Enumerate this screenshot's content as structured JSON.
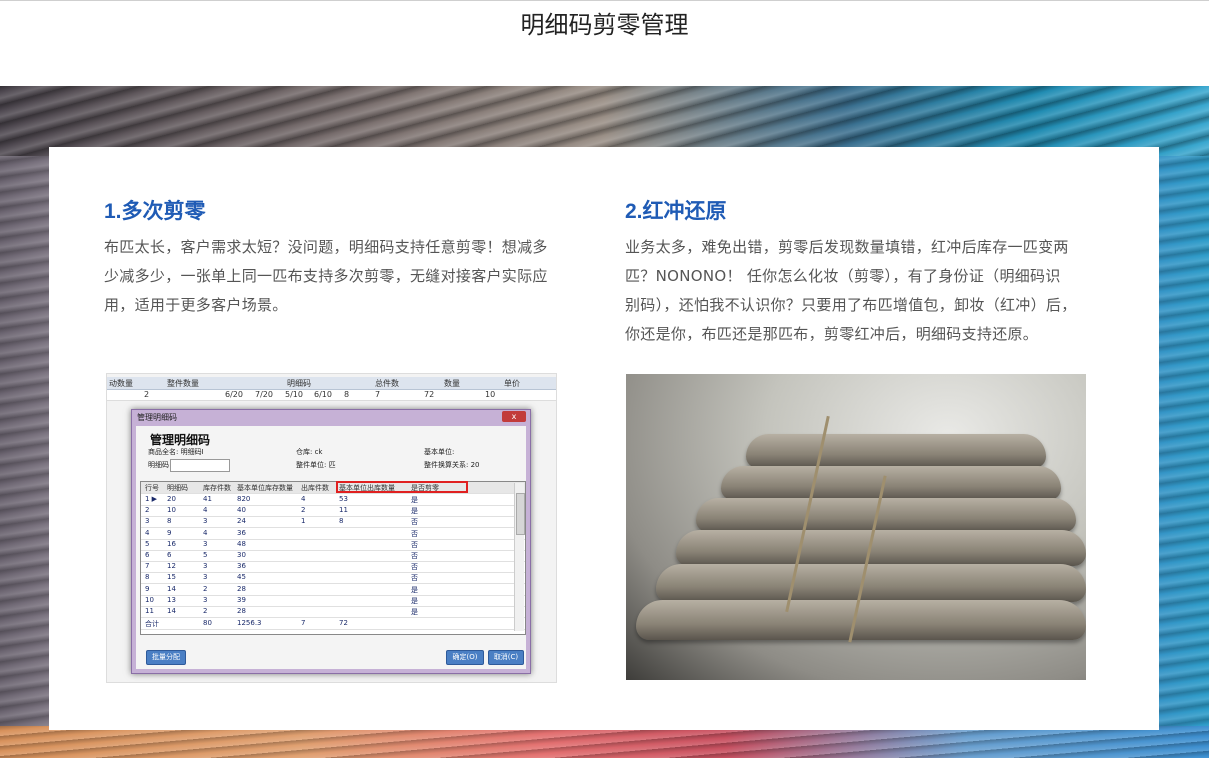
{
  "page": {
    "title": "明细码剪零管理"
  },
  "sections": [
    {
      "heading": "1.多次剪零",
      "lines": [
        "布匹太长，客户需求太短？没问题，明细码支持任意剪零！想减多",
        "少减多少，一张单上同一匹布支持多次剪零，无缝对接客户实际应",
        "用，适用于更多客户场景。"
      ]
    },
    {
      "heading": "2.红冲还原",
      "lines": [
        "业务太多，难免出错，剪零后发现数量填错，红冲后库存一匹变两",
        "匹？NONONO！  任你怎么化妆（剪零），有了身份证（明细码识",
        "别码），还怕我不认识你？只要用了布匹增值包，卸妆（红冲）后，",
        "你还是你，布匹还是那匹布，剪零红冲后，明细码支持还原。"
      ]
    }
  ],
  "screenshot": {
    "sheet_headers": [
      "动数量",
      "整件数量",
      "明细码",
      "总件数",
      "数量",
      "单价"
    ],
    "sheet_row": [
      "2",
      "6/20",
      "7/20",
      "5/10",
      "6/10",
      "8",
      "7",
      "72",
      "10"
    ],
    "dialog": {
      "window_title": "管理明细码",
      "close_label": "x",
      "heading": "管理明细码",
      "product_label": "商品全名: 明细码I",
      "code_label": "明细码",
      "warehouse_label": "仓库: ck",
      "unit_label": "整件单位: 匹",
      "base_unit_label": "基本单位:",
      "ratio_label": "整件换算关系: 20",
      "columns": [
        "行号",
        "明细码",
        "库存件数",
        "基本单位库存数量",
        "出库件数",
        "基本单位出库数量",
        "是否剪零"
      ],
      "rows": [
        [
          "1 ▶",
          "20",
          "41",
          "820",
          "4",
          "53",
          "是"
        ],
        [
          "2",
          "10",
          "4",
          "40",
          "2",
          "11",
          "是"
        ],
        [
          "3",
          "8",
          "3",
          "24",
          "1",
          "8",
          "否"
        ],
        [
          "4",
          "9",
          "4",
          "36",
          "",
          "",
          "否"
        ],
        [
          "5",
          "16",
          "3",
          "48",
          "",
          "",
          "否"
        ],
        [
          "6",
          "6",
          "5",
          "30",
          "",
          "",
          "否"
        ],
        [
          "7",
          "12",
          "3",
          "36",
          "",
          "",
          "否"
        ],
        [
          "8",
          "15",
          "3",
          "45",
          "",
          "",
          "否"
        ],
        [
          "9",
          "14",
          "2",
          "28",
          "",
          "",
          "是"
        ],
        [
          "10",
          "13",
          "3",
          "39",
          "",
          "",
          "是"
        ],
        [
          "11",
          "14",
          "2",
          "28",
          "",
          "",
          "是"
        ]
      ],
      "total_row": [
        "合计",
        "",
        "80",
        "1256.3",
        "7",
        "72",
        ""
      ],
      "batch_button": "批量分配",
      "ok_button": "确定(O)",
      "cancel_button": "取消(C)"
    }
  },
  "colors": {
    "heading": "#1f5bb5",
    "body_text": "#555555",
    "highlight": "#e02020"
  }
}
